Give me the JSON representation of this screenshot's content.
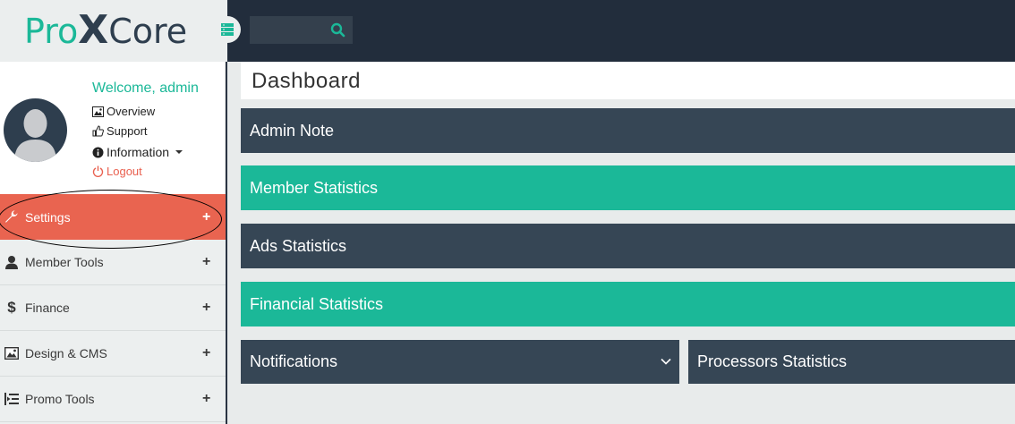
{
  "brand": {
    "part1": "Pro",
    "part2": "X",
    "part3": "Core"
  },
  "search": {
    "placeholder": "",
    "icon": "search-icon"
  },
  "profile": {
    "welcome": "Welcome, admin",
    "links": [
      {
        "label": "Overview",
        "icon": "image-icon"
      },
      {
        "label": "Support",
        "icon": "thumbs-up-icon"
      },
      {
        "label": "Information",
        "icon": "info-icon"
      },
      {
        "label": "Logout",
        "icon": "power-icon"
      }
    ]
  },
  "sidebar": {
    "items": [
      {
        "label": "Settings",
        "icon": "wrench-icon",
        "active": true
      },
      {
        "label": "Member Tools",
        "icon": "user-icon"
      },
      {
        "label": "Finance",
        "icon": "dollar-icon"
      },
      {
        "label": "Design & CMS",
        "icon": "image-icon"
      },
      {
        "label": "Promo Tools",
        "icon": "indent-icon"
      }
    ],
    "expand_symbol": "+"
  },
  "main": {
    "title": "Dashboard",
    "panels": [
      {
        "label": "Admin Note"
      },
      {
        "label": "Member Statistics"
      },
      {
        "label": "Ads Statistics"
      },
      {
        "label": "Financial Statistics"
      },
      {
        "label": "Notifications"
      },
      {
        "label": "Processors Statistics"
      }
    ]
  },
  "colors": {
    "accent": "#1bb898",
    "dark": "#364655",
    "active": "#e96450",
    "topbar": "#222d3c"
  }
}
